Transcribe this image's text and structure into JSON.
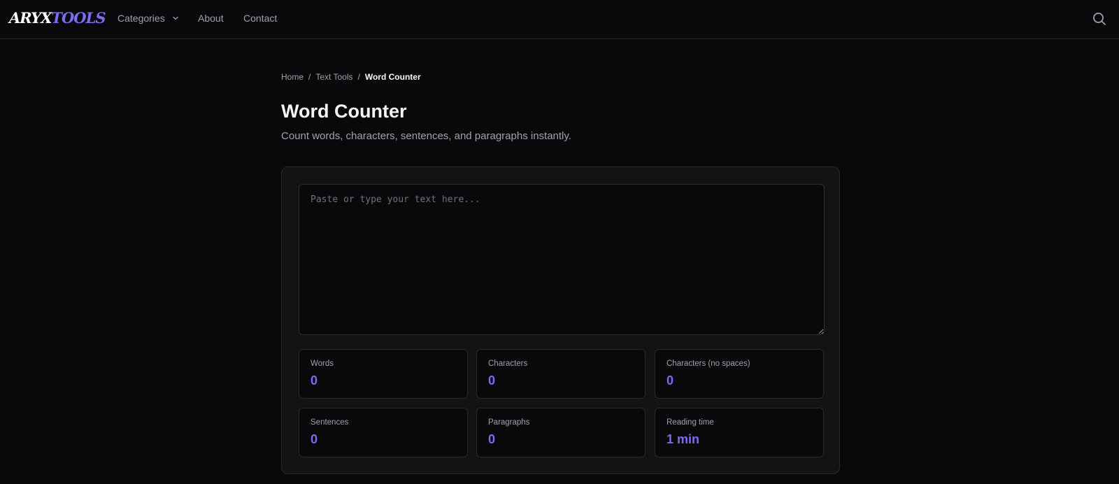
{
  "brand": {
    "logo_part1": "ARYX",
    "logo_part2": "TOOLS"
  },
  "nav": {
    "categories": "Categories",
    "about": "About",
    "contact": "Contact"
  },
  "breadcrumb": {
    "home": "Home",
    "section": "Text Tools",
    "current": "Word Counter",
    "separator": "/"
  },
  "page": {
    "title": "Word Counter",
    "subtitle": "Count words, characters, sentences, and paragraphs instantly."
  },
  "editor": {
    "placeholder": "Paste or type your text here...",
    "value": ""
  },
  "stats": [
    {
      "label": "Words",
      "value": "0"
    },
    {
      "label": "Characters",
      "value": "0"
    },
    {
      "label": "Characters (no spaces)",
      "value": "0"
    },
    {
      "label": "Sentences",
      "value": "0"
    },
    {
      "label": "Paragraphs",
      "value": "0"
    },
    {
      "label": "Reading time",
      "value": "1 min"
    }
  ],
  "icons": {
    "search": "search-icon",
    "dropdown": "chevron-down-icon"
  },
  "colors": {
    "accent": "#7c6cf0",
    "background": "#09090b",
    "card": "#131316"
  }
}
